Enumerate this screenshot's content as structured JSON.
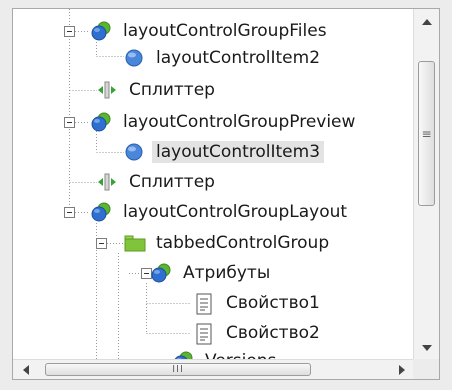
{
  "colors": {
    "background": "#ececec",
    "panel": "#ffffff",
    "selected_bg": "#e3e3e3",
    "group_icon_blue": "#2f6fd0",
    "group_icon_green": "#5cb531",
    "item_icon_blue": "#4a86d9",
    "splitter_green": "#3aa23a",
    "folder_green": "#7fc43a"
  },
  "tree": {
    "nodes": [
      {
        "label": "layoutControlGroupFiles",
        "icon": "layout-group-icon",
        "expanded": true
      },
      {
        "label": "layoutControlItem2",
        "icon": "layout-item-icon"
      },
      {
        "label": "Сплиттер",
        "icon": "splitter-icon"
      },
      {
        "label": "layoutControlGroupPreview",
        "icon": "layout-group-icon",
        "expanded": true
      },
      {
        "label": "layoutControlItem3",
        "icon": "layout-item-icon",
        "selected": true
      },
      {
        "label": "Сплиттер",
        "icon": "splitter-icon"
      },
      {
        "label": "layoutControlGroupLayout",
        "icon": "layout-group-icon",
        "expanded": true
      },
      {
        "label": "tabbedControlGroup",
        "icon": "tabbed-group-icon",
        "expanded": true
      },
      {
        "label": "Атрибуты",
        "icon": "layout-group-icon",
        "expanded": true
      },
      {
        "label": "Свойство1",
        "icon": "document-icon"
      },
      {
        "label": "Свойство2",
        "icon": "document-icon"
      },
      {
        "label": "Versions",
        "icon": "layout-group-icon"
      }
    ]
  },
  "scrollbar": {
    "horizontal_grip": "III",
    "vertical_grip": "≡"
  }
}
